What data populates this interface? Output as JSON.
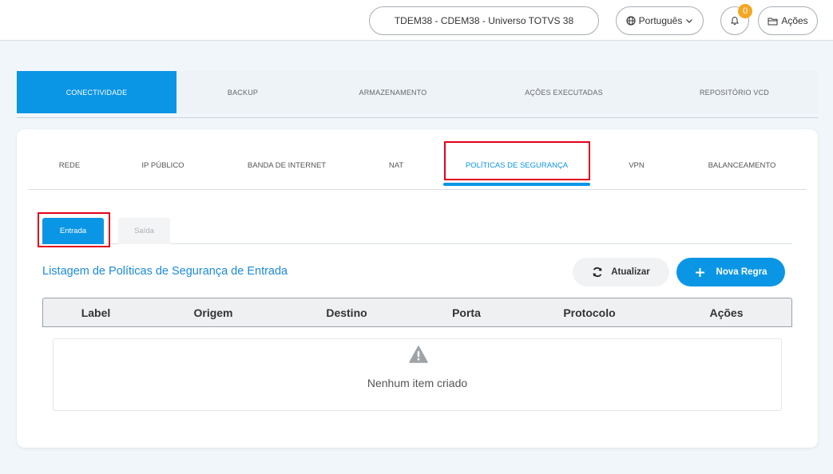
{
  "header": {
    "context": "TDEM38 - CDEM38 - Universo TOTVS 38",
    "language": "Português",
    "notifications_count": "0",
    "actions_label": "Ações"
  },
  "main_tabs": [
    {
      "label": "CONECTIVIDADE",
      "active": true
    },
    {
      "label": "BACKUP",
      "active": false
    },
    {
      "label": "ARMAZENAMENTO",
      "active": false
    },
    {
      "label": "AÇÕES EXECUTADAS",
      "active": false
    },
    {
      "label": "REPOSITÓRIO VCD",
      "active": false
    }
  ],
  "sub_tabs": [
    {
      "label": "REDE",
      "active": false
    },
    {
      "label": "IP PÚBLICO",
      "active": false
    },
    {
      "label": "BANDA DE INTERNET",
      "active": false
    },
    {
      "label": "NAT",
      "active": false
    },
    {
      "label": "POLÍTICAS DE SEGURANÇA",
      "active": true
    },
    {
      "label": "VPN",
      "active": false
    },
    {
      "label": "BALANCEAMENTO",
      "active": false
    }
  ],
  "direction_tabs": [
    {
      "label": "Entrada",
      "active": true
    },
    {
      "label": "Saída",
      "active": false
    }
  ],
  "list": {
    "title": "Listagem de Políticas de Segurança de Entrada",
    "refresh_label": "Atualizar",
    "new_rule_label": "Nova Regra"
  },
  "table": {
    "columns": [
      "Label",
      "Origem",
      "Destino",
      "Porta",
      "Protocolo",
      "Ações"
    ]
  },
  "empty_state": {
    "message": "Nenhum item criado"
  },
  "colors": {
    "accent": "#0b96e5",
    "highlight": "#e3001b",
    "badge": "#f5a623"
  },
  "icons": {
    "language": "globe-icon",
    "notifications": "bell-icon",
    "actions": "folder-icon",
    "refresh": "refresh-icon",
    "new_rule": "plus-icon",
    "empty": "warning-icon"
  }
}
